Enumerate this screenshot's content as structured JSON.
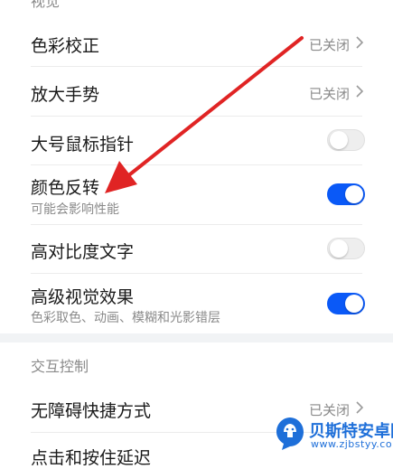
{
  "sections": {
    "vision_label": "视觉",
    "interaction_label": "交互控制"
  },
  "rows": {
    "color_correction": {
      "title": "色彩校正",
      "value": "已关闭"
    },
    "magnify_gesture": {
      "title": "放大手势",
      "value": "已关闭"
    },
    "large_pointer": {
      "title": "大号鼠标指针",
      "state": "off"
    },
    "color_inversion": {
      "title": "颜色反转",
      "subtitle": "可能会影响性能",
      "state": "on"
    },
    "high_contrast_text": {
      "title": "高对比度文字",
      "state": "off"
    },
    "advanced_visual": {
      "title": "高级视觉效果",
      "subtitle": "色彩取色、动画、模糊和光影错层",
      "state": "on"
    },
    "accessibility_shortcut": {
      "title": "无障碍快捷方式",
      "value": "已关闭"
    },
    "touch_hold_delay": {
      "title": "点击和按住延迟"
    }
  },
  "colors": {
    "toggle_on": "#0a59f7",
    "annotation_arrow": "#e02424",
    "watermark": "#1e6fd9"
  },
  "watermark": {
    "brand": "贝斯特安卓网",
    "url": "www.zjbstyy.com"
  }
}
